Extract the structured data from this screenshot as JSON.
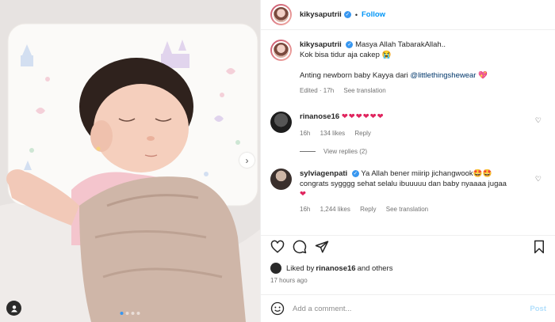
{
  "post": {
    "username": "kikysaputrii",
    "follow_label": "Follow",
    "bullet": "•"
  },
  "caption": {
    "username": "kikysaputrii",
    "line1": "Masya Allah TabarakAllah..",
    "line2": "Kok bisa tidur aja cakep 😭",
    "line3_prefix": "Anting newborn baby Kayya dari ",
    "mention": "@littlethingshewear",
    "line3_suffix": " 💖",
    "edited": "Edited · 17h",
    "see_translation": "See translation"
  },
  "comments": [
    {
      "username": "rinanose16",
      "text": "❤❤❤❤❤❤",
      "time": "16h",
      "likes": "134 likes",
      "reply": "Reply"
    },
    {
      "username": "sylviagenpati",
      "text_line1": "Ya Allah bener miirip jichangwook🤩🤩",
      "text_line2": "congrats sygggg sehat selalu ibuuuuu dan baby nyaaaa jugaa",
      "text_line3": "❤",
      "time": "16h",
      "likes": "1,244 likes",
      "reply": "Reply",
      "see_translation": "See translation"
    }
  ],
  "view_replies": "View replies (2)",
  "liked_by": {
    "prefix": "Liked by ",
    "user": "rinanose16",
    "suffix": " and others"
  },
  "time_ago": "17 hours ago",
  "add_comment": {
    "placeholder": "Add a comment...",
    "post_label": "Post"
  },
  "carousel": {
    "slides": 4,
    "active": 1
  },
  "colors": {
    "accent": "#0095f6",
    "heart": "#e0245e",
    "muted": "#737373"
  },
  "icons": [
    "heart-icon",
    "comment-icon",
    "share-icon",
    "bookmark-icon",
    "smiley-icon",
    "tag-person-icon",
    "chevron-right-icon",
    "verified-icon"
  ]
}
